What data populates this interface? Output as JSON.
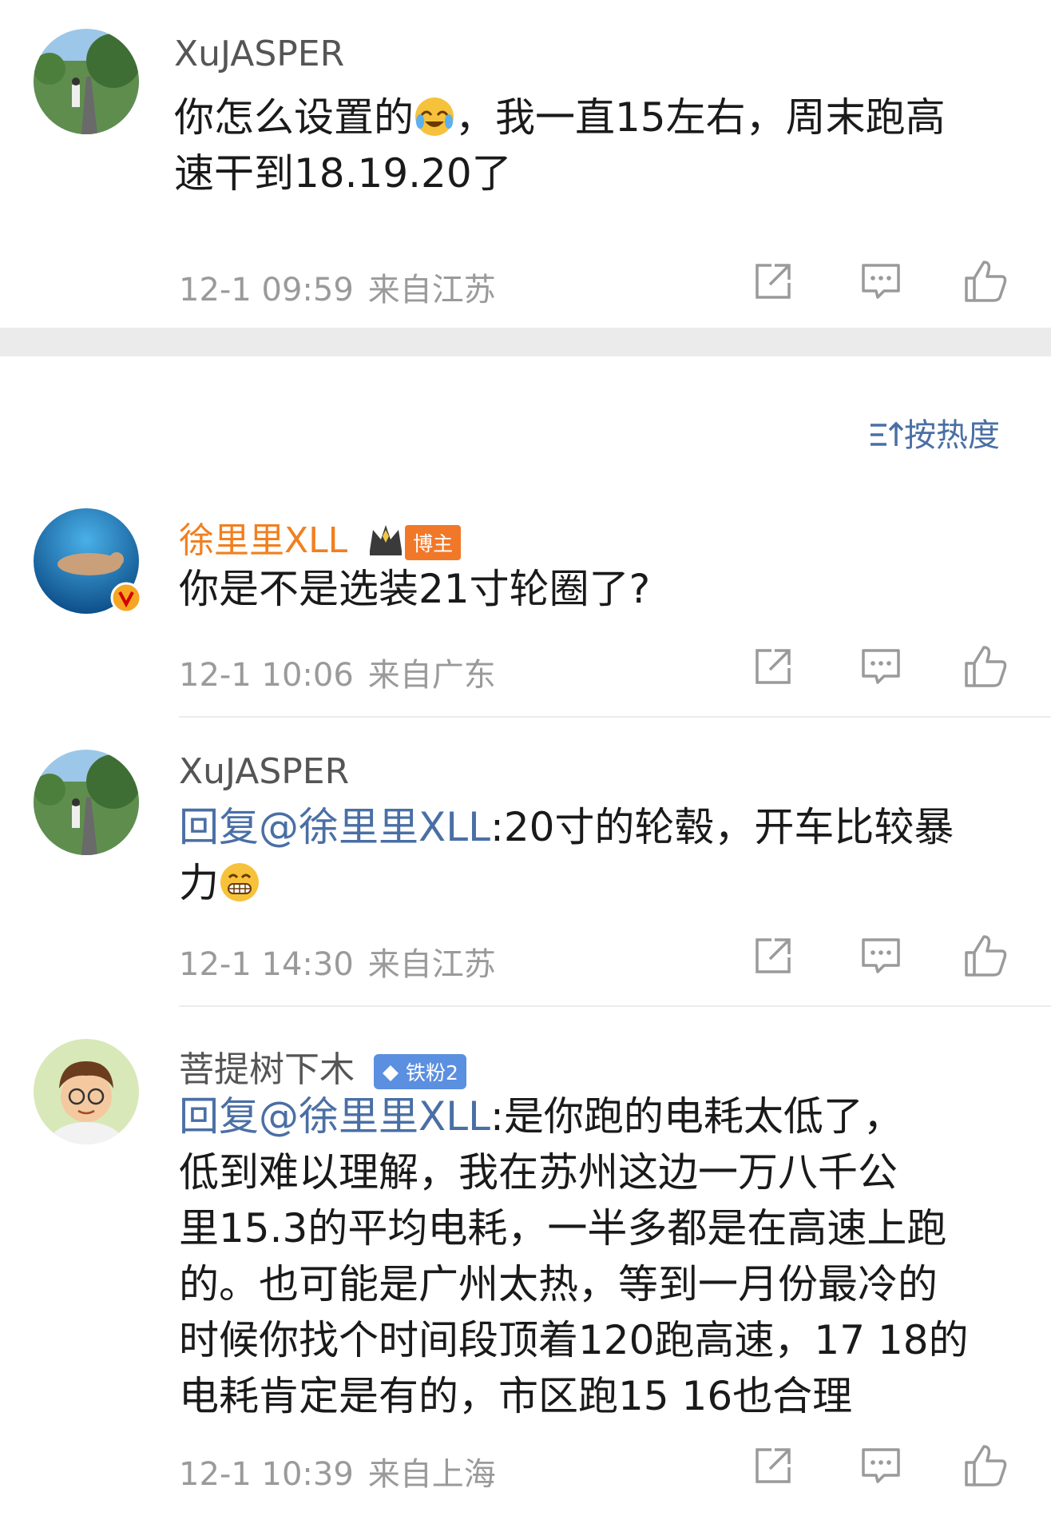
{
  "top_comment": {
    "username": "XuJASPER",
    "text_line1_a": "你怎么设置的",
    "emoji": "laugh-cry",
    "text_line1_b": "，我一直15左右，周末跑高",
    "text_line2": "速干到18.19.20了",
    "time": "12-1 09:59",
    "location": "来自江苏"
  },
  "sort_label": "按热度",
  "replies": [
    {
      "username": "徐里里XLL",
      "badge": "博主",
      "text_line1": "你是不是选装21寸轮圈了?",
      "time": "12-1 10:06",
      "location": "来自广东"
    },
    {
      "username": "XuJASPER",
      "mention": "回复@徐里里XLL",
      "text_line1_rest": ":20寸的轮毂，开车比较暴",
      "text_line2": "力",
      "emoji": "grin",
      "time": "12-1 14:30",
      "location": "来自江苏"
    },
    {
      "username": "菩提树下木",
      "badge": "铁粉2",
      "mention": "回复@徐里里XLL",
      "text_line1_rest": ":是你跑的电耗太低了，",
      "text_line2": "低到难以理解，我在苏州这边一万八千公",
      "text_line3": "里15.3的平均电耗，一半多都是在高速上跑",
      "text_line4": "的。也可能是广州太热，等到一月份最冷的",
      "text_line5": "时候你找个时间段顶着120跑高速，17 18的",
      "text_line6": "电耗肯定是有的，市区跑15 16也合理",
      "time": "12-1 10:39",
      "location": "来自上海"
    }
  ],
  "colors": {
    "mention": "#4a6fa5",
    "blogger_name": "#f08020",
    "meta": "#9a9a9a"
  },
  "icons": [
    "share-icon",
    "comment-icon",
    "like-icon",
    "sort-icon",
    "verified-icon",
    "crown-icon",
    "diamond-icon"
  ]
}
